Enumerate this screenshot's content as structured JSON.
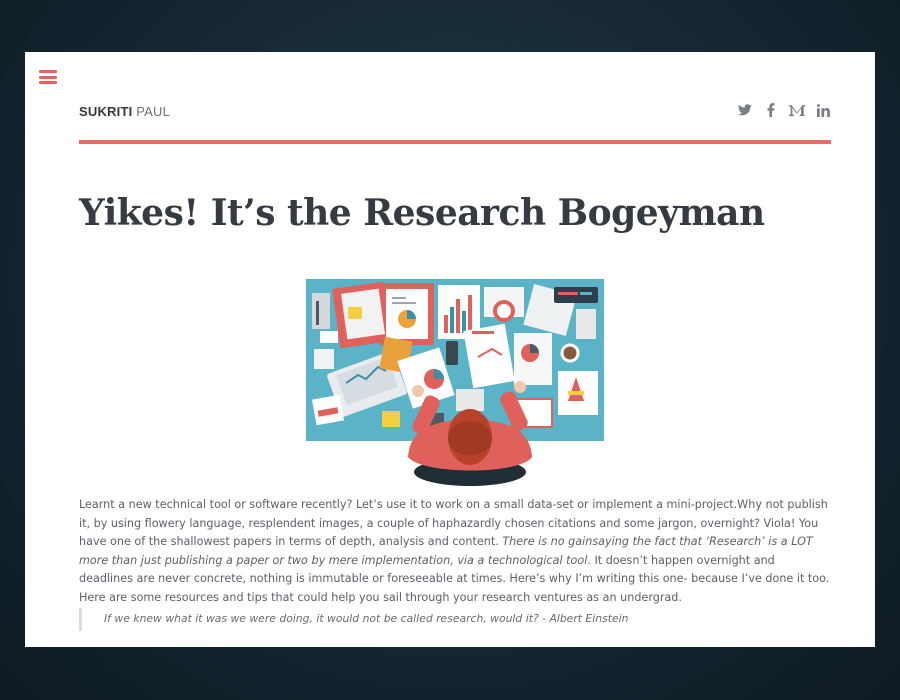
{
  "header": {
    "brand_first": "SUKRITI",
    "brand_last": "PAUL",
    "social_icons": [
      "twitter-icon",
      "facebook-icon",
      "medium-icon",
      "linkedin-icon"
    ]
  },
  "menu_icon": "hamburger-menu-icon",
  "article": {
    "title": "Yikes! It’s the Research Bogeyman",
    "hero_image": "illustration-person-at-desk-with-research-papers",
    "intro_part1": "Learnt a new technical tool or software recently? Let’s use it to work on a small data-set or implement a mini-project.Why not publish it, by using flowery language, resplendent images, a couple of haphazardly chosen citations and some jargon, overnight? Viola! You have one of the shallowest papers in terms of depth, analysis and content. ",
    "intro_emphasis": "There is no gainsaying the fact that ‘Research’ is a LOT more than just publishing a paper or two by mere implementation, via a technological tool",
    "intro_part2": ". It doesn’t happen overnight and deadlines are never concrete, nothing is immutable or foreseeable at times. Here’s why I’m writing this one- because I’ve done it too. Here are some resources and tips that could help you sail through your research ventures as an undergrad.",
    "quote": "If we knew what it was we were doing, it would not be called research, would it? - Albert Einstein"
  },
  "colors": {
    "accent": "#ea6a64",
    "text_dark": "#353b41",
    "text_body": "#5b6168",
    "hero_bg": "#5ab3c6"
  }
}
